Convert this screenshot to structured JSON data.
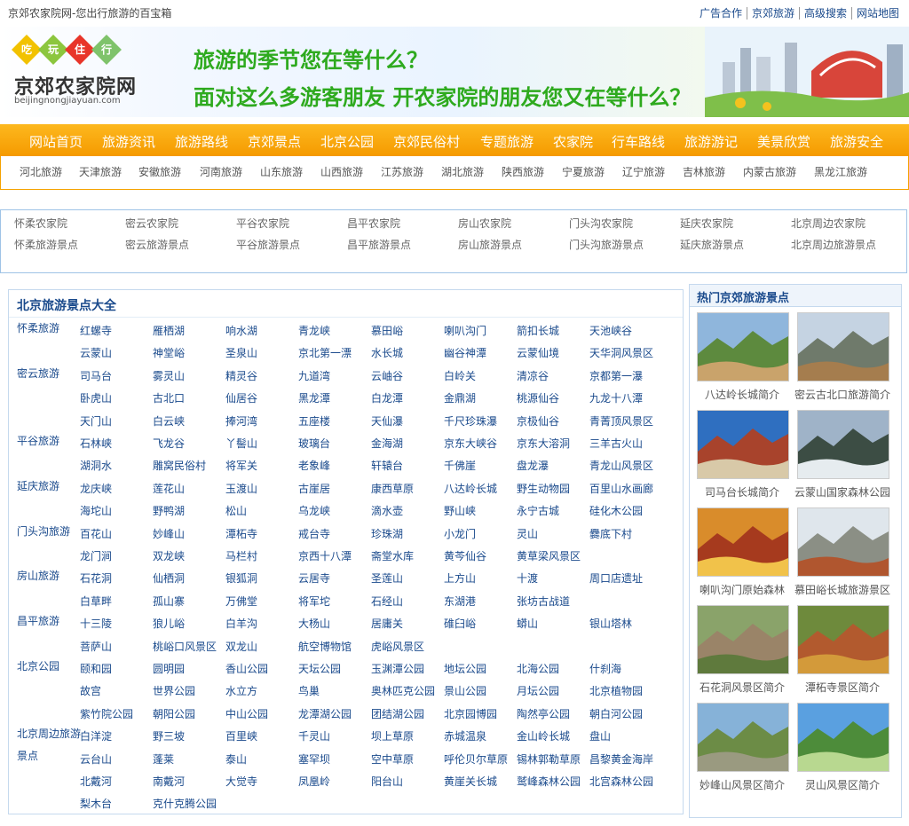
{
  "topbar": {
    "site_title": "京郊农家院网-您出行旅游的百宝箱",
    "links": [
      "广告合作",
      "京郊旅游",
      "高级搜索",
      "网站地图"
    ]
  },
  "banner": {
    "badges": [
      {
        "char": "吃",
        "color": "#f2c200"
      },
      {
        "char": "玩",
        "color": "#8cc63e"
      },
      {
        "char": "住",
        "color": "#e8352a"
      },
      {
        "char": "行",
        "color": "#7fc36b"
      }
    ],
    "logo_text": "京郊农家院网",
    "logo_url": "beijingnongjiayuan.com",
    "slogan_1": "旅游的季节您在等什么？",
    "slogan_2": "面对这么多游客朋友  开农家院的朋友您又在等什么？"
  },
  "main_nav": [
    "网站首页",
    "旅游资讯",
    "旅游路线",
    "京郊景点",
    "北京公园",
    "京郊民俗村",
    "专题旅游",
    "农家院",
    "行车路线",
    "旅游游记",
    "美景欣赏",
    "旅游安全"
  ],
  "sub_nav": [
    "河北旅游",
    "天津旅游",
    "安徽旅游",
    "河南旅游",
    "山东旅游",
    "山西旅游",
    "江苏旅游",
    "湖北旅游",
    "陕西旅游",
    "宁夏旅游",
    "辽宁旅游",
    "吉林旅游",
    "内蒙古旅游",
    "黑龙江旅游"
  ],
  "quick_links": {
    "row1": [
      "怀柔农家院",
      "密云农家院",
      "平谷农家院",
      "昌平农家院",
      "房山农家院",
      "门头沟农家院",
      "延庆农家院",
      "北京周边农家院"
    ],
    "row2": [
      "怀柔旅游景点",
      "密云旅游景点",
      "平谷旅游景点",
      "昌平旅游景点",
      "房山旅游景点",
      "门头沟旅游景点",
      "延庆旅游景点",
      "北京周边旅游景点"
    ]
  },
  "scenic": {
    "title": "北京旅游景点大全",
    "groups": [
      {
        "district": "怀柔旅游",
        "rows": [
          [
            "红螺寺",
            "雁栖湖",
            "响水湖",
            "青龙峡",
            "慕田峪",
            "喇叭沟门",
            "箭扣长城",
            "天池峡谷"
          ],
          [
            "云蒙山",
            "神堂峪",
            "圣泉山",
            "京北第一漂",
            "水长城",
            "幽谷神潭",
            "云蒙仙境",
            "天华洞风景区"
          ]
        ]
      },
      {
        "district": "密云旅游",
        "rows": [
          [
            "司马台",
            "雾灵山",
            "精灵谷",
            "九道湾",
            "云岫谷",
            "白岭关",
            "清凉谷",
            "京都第一瀑"
          ],
          [
            "卧虎山",
            "古北口",
            "仙居谷",
            "黑龙潭",
            "白龙潭",
            "金鼎湖",
            "桃源仙谷",
            "九龙十八潭"
          ],
          [
            "天门山",
            "白云峡",
            "捧河湾",
            "五座楼",
            "天仙瀑",
            "千尺珍珠瀑",
            "京极仙谷",
            "青菁顶风景区"
          ]
        ]
      },
      {
        "district": "平谷旅游",
        "rows": [
          [
            "石林峡",
            "飞龙谷",
            "丫髻山",
            "玻璃台",
            "金海湖",
            "京东大峡谷",
            "京东大溶洞",
            "三羊古火山"
          ],
          [
            "湖洞水",
            "雕窝民俗村",
            "将军关",
            "老象峰",
            "轩辕台",
            "千佛崖",
            "盘龙瀑",
            "青龙山风景区"
          ]
        ]
      },
      {
        "district": "延庆旅游",
        "rows": [
          [
            "龙庆峡",
            "莲花山",
            "玉渡山",
            "古崖居",
            "康西草原",
            "八达岭长城",
            "野生动物园",
            "百里山水画廊"
          ],
          [
            "海坨山",
            "野鸭湖",
            "松山",
            "乌龙峡",
            "滴水壶",
            "野山峡",
            "永宁古城",
            "硅化木公园"
          ]
        ]
      },
      {
        "district": "门头沟旅游",
        "rows": [
          [
            "百花山",
            "妙峰山",
            "潭柘寺",
            "戒台寺",
            "珍珠湖",
            "小龙门",
            "灵山",
            "爨底下村"
          ],
          [
            "龙门涧",
            "双龙峡",
            "马栏村",
            "京西十八潭",
            "斋堂水库",
            "黄芩仙谷",
            "黄草梁风景区"
          ]
        ]
      },
      {
        "district": "房山旅游",
        "rows": [
          [
            "石花洞",
            "仙栖洞",
            "银狐洞",
            "云居寺",
            "圣莲山",
            "上方山",
            "十渡",
            "周口店遗址"
          ],
          [
            "白草畔",
            "孤山寨",
            "万佛堂",
            "将军坨",
            "石经山",
            "东湖港",
            "张坊古战道"
          ]
        ]
      },
      {
        "district": "昌平旅游",
        "rows": [
          [
            "十三陵",
            "狼儿峪",
            "白羊沟",
            "大杨山",
            "居庸关",
            "碓臼峪",
            "蟒山",
            "银山塔林"
          ],
          [
            "菩萨山",
            "桃峪口风景区",
            "双龙山",
            "航空博物馆",
            "虎峪风景区"
          ]
        ]
      },
      {
        "district": "北京公园",
        "rows": [
          [
            "颐和园",
            "圆明园",
            "香山公园",
            "天坛公园",
            "玉渊潭公园",
            "地坛公园",
            "北海公园",
            "什刹海"
          ],
          [
            "故宫",
            "世界公园",
            "水立方",
            "鸟巢",
            "奥林匹克公园",
            "景山公园",
            "月坛公园",
            "北京植物园"
          ],
          [
            "紫竹院公园",
            "朝阳公园",
            "中山公园",
            "龙潭湖公园",
            "团结湖公园",
            "北京园博园",
            "陶然亭公园",
            "朝白河公园"
          ]
        ]
      },
      {
        "district": "北京周边旅游景点",
        "rows": [
          [
            "白洋淀",
            "野三坡",
            "百里峡",
            "千灵山",
            "坝上草原",
            "赤城温泉",
            "金山岭长城",
            "盘山"
          ],
          [
            "云台山",
            "蓬莱",
            "泰山",
            "塞罕坝",
            "空中草原",
            "呼伦贝尔草原",
            "锡林郭勒草原",
            "昌黎黄金海岸"
          ],
          [
            "北戴河",
            "南戴河",
            "大觉寺",
            "凤凰岭",
            "阳台山",
            "黄崖关长城",
            "鹫峰森林公园",
            "北宫森林公园"
          ],
          [
            "梨木台",
            "克什克腾公园"
          ]
        ]
      }
    ]
  },
  "hot_spots": {
    "title": "热门京郊旅游景点",
    "items": [
      {
        "caption": "八达岭长城简介"
      },
      {
        "caption": "密云古北口旅游简介"
      },
      {
        "caption": "司马台长城简介"
      },
      {
        "caption": "云蒙山国家森林公园"
      },
      {
        "caption": "喇叭沟门原始森林"
      },
      {
        "caption": "慕田峪长城旅游景区"
      },
      {
        "caption": "石花洞风景区简介"
      },
      {
        "caption": "潭柘寺景区简介"
      },
      {
        "caption": "妙峰山风景区简介"
      },
      {
        "caption": "灵山风景区简介"
      }
    ]
  }
}
